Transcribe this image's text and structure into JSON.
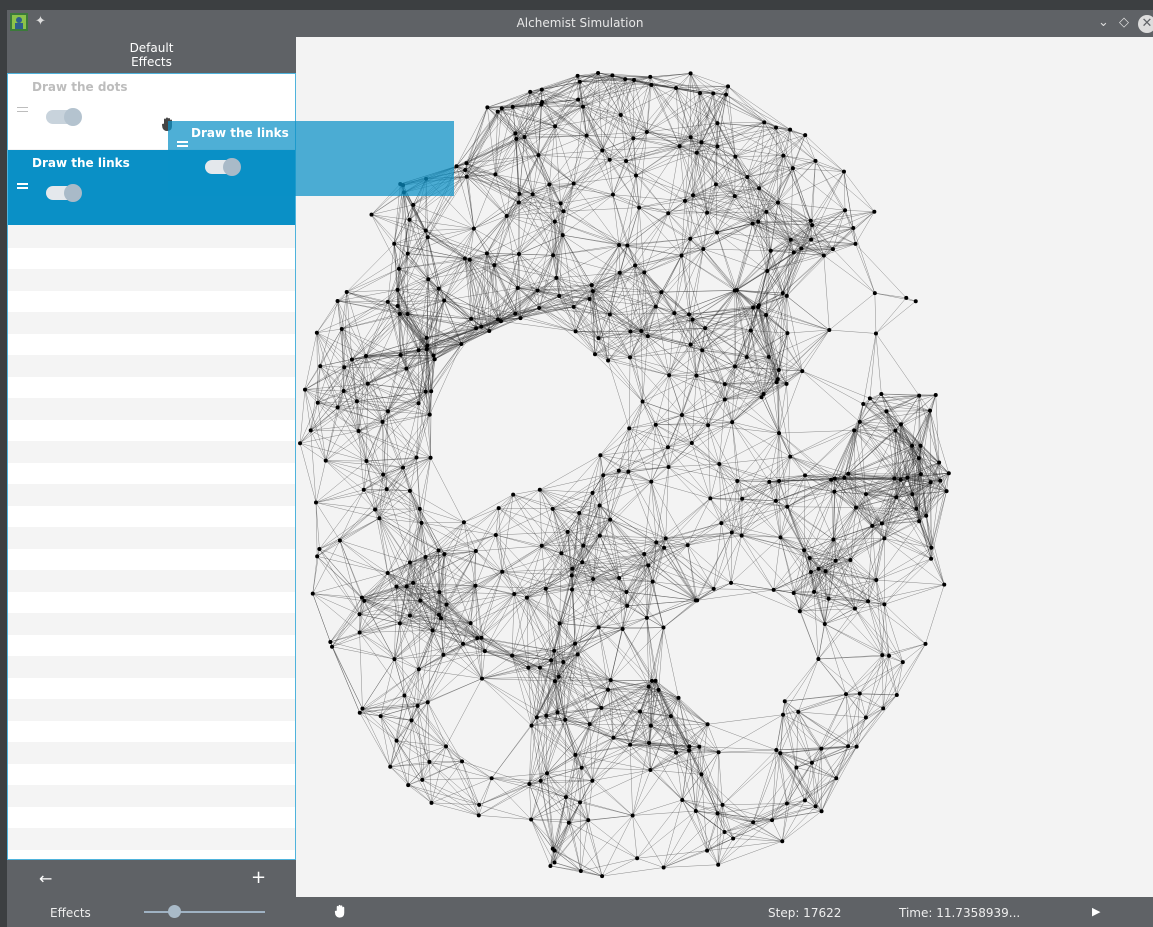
{
  "window": {
    "title": "Alchemist Simulation",
    "pin_glyph": "✦",
    "minimize_glyph": "⌄",
    "restore_glyph": "◇",
    "close_glyph": "✕"
  },
  "sidebar": {
    "header_line1": "Default",
    "header_line2": "Effects",
    "effects": [
      {
        "name": "Draw the dots",
        "enabled": true,
        "selected": false
      },
      {
        "name": "Draw the links",
        "enabled": true,
        "selected": true
      }
    ],
    "drag_ghost": {
      "name": "Draw the links",
      "enabled": true
    },
    "back_glyph": "←",
    "add_glyph": "+"
  },
  "statusbar": {
    "effects_label": "Effects",
    "zoom_level": 0.25,
    "step_text": "Step: 17622",
    "time_text": "Time: 11.7358939...",
    "play_glyph": "▶"
  },
  "colors": {
    "chrome": "#5f6266",
    "selected": "#0a90c6",
    "canvas": "#f3f3f3",
    "node": "#000000",
    "link": "#333333"
  },
  "icons": {
    "app": "app-icon",
    "pin": "pin-icon",
    "pan": "hand-icon",
    "grab": "grab-cursor-icon",
    "play": "play-icon"
  }
}
